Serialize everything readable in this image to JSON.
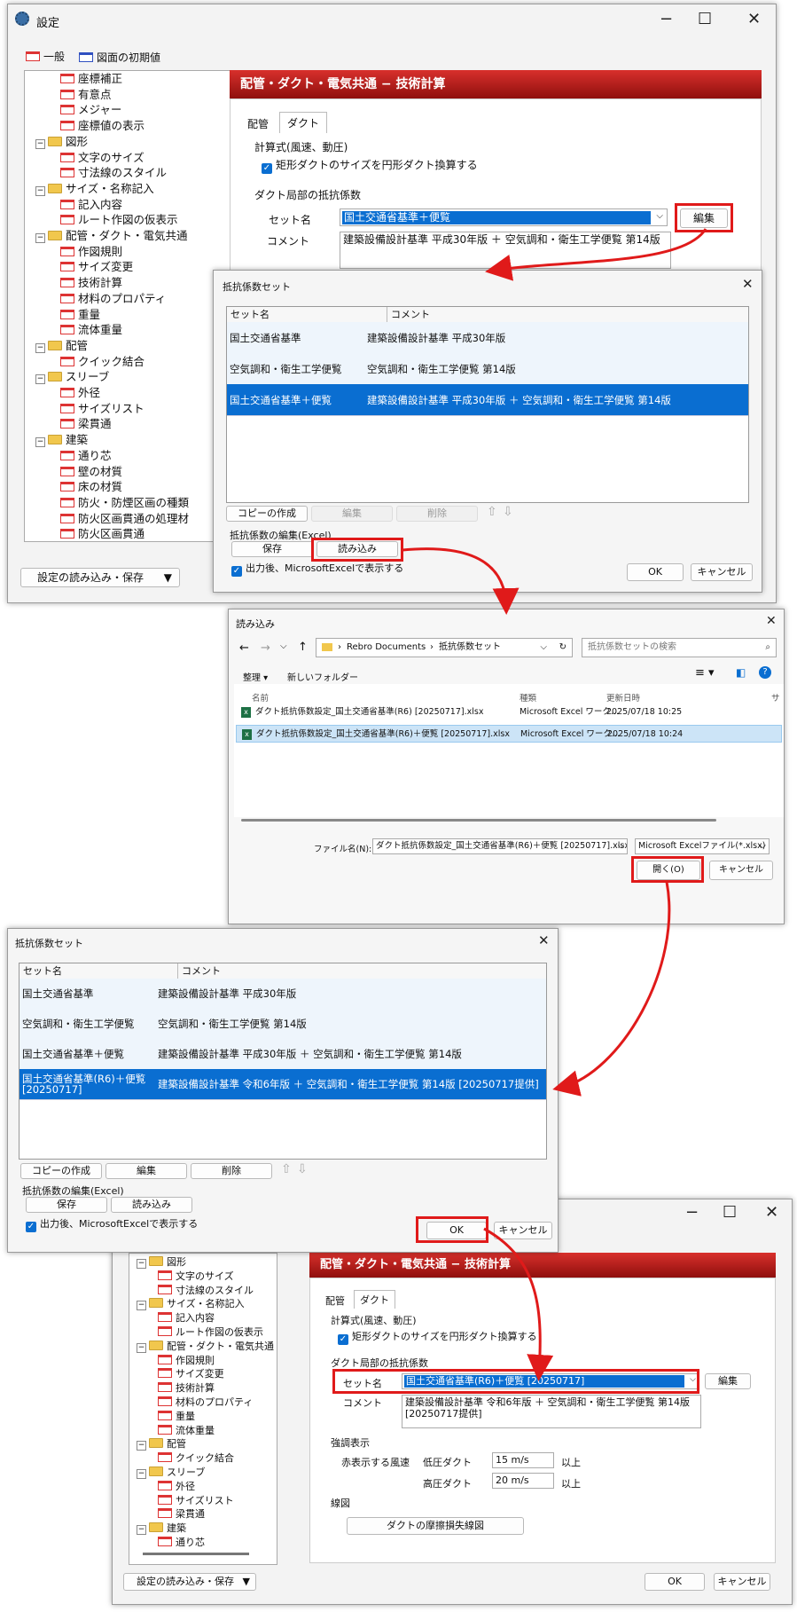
{
  "settings": {
    "title": "設定",
    "top_tabs": [
      "一般",
      "図面の初期値"
    ],
    "tree1": [
      {
        "label": "座標補正",
        "lvl": 2
      },
      {
        "label": "有意点",
        "lvl": 2
      },
      {
        "label": "メジャー",
        "lvl": 2
      },
      {
        "label": "座標値の表示",
        "lvl": 2
      },
      {
        "label": "図形",
        "lvl": 1
      },
      {
        "label": "文字のサイズ",
        "lvl": 2
      },
      {
        "label": "寸法線のスタイル",
        "lvl": 2
      },
      {
        "label": "サイズ・名称記入",
        "lvl": 1
      },
      {
        "label": "記入内容",
        "lvl": 2
      },
      {
        "label": "ルート作図の仮表示",
        "lvl": 2
      },
      {
        "label": "配管・ダクト・電気共通",
        "lvl": 1
      },
      {
        "label": "作図規則",
        "lvl": 2
      },
      {
        "label": "サイズ変更",
        "lvl": 2
      },
      {
        "label": "技術計算",
        "lvl": 2
      },
      {
        "label": "材料のプロパティ",
        "lvl": 2
      },
      {
        "label": "重量",
        "lvl": 2
      },
      {
        "label": "流体重量",
        "lvl": 2
      },
      {
        "label": "配管",
        "lvl": 1
      },
      {
        "label": "クイック結合",
        "lvl": 2
      },
      {
        "label": "スリーブ",
        "lvl": 1
      },
      {
        "label": "外径",
        "lvl": 2
      },
      {
        "label": "サイズリスト",
        "lvl": 2
      },
      {
        "label": "梁貫通",
        "lvl": 2
      },
      {
        "label": "建築",
        "lvl": 1
      },
      {
        "label": "通り芯",
        "lvl": 2
      },
      {
        "label": "壁の材質",
        "lvl": 2
      },
      {
        "label": "床の材質",
        "lvl": 2
      },
      {
        "label": "防火・防煙区画の種類",
        "lvl": 2
      },
      {
        "label": "防火区画貫通の処理材",
        "lvl": 2
      },
      {
        "label": "防火区画貫通",
        "lvl": 2
      }
    ],
    "load_save_btn": "設定の読み込み・保存",
    "panel_header": "配管・ダクト・電気共通 − 技術計算",
    "inner_tabs": [
      "配管",
      "ダクト"
    ],
    "formula_group": "計算式(風速、動圧)",
    "convert_check": "矩形ダクトのサイズを円形ダクト換算する",
    "resistance_group": "ダクト局部の抵抗係数",
    "set_name_label": "セット名",
    "set_name_value": "国土交通省基準＋便覧",
    "edit_btn": "編集",
    "comment_label": "コメント",
    "comment_value": "建築設備設計基準 平成30年版 ＋ 空気調和・衛生工学便覧 第14版"
  },
  "coef1": {
    "title": "抵抗係数セット",
    "col_set": "セット名",
    "col_comment": "コメント",
    "rows": [
      {
        "name": "国土交通省基準",
        "comment": "建築設備設計基準 平成30年版"
      },
      {
        "name": "空気調和・衛生工学便覧",
        "comment": "空気調和・衛生工学便覧 第14版"
      },
      {
        "name": "国土交通省基準＋便覧",
        "comment": "建築設備設計基準 平成30年版 ＋ 空気調和・衛生工学便覧 第14版"
      }
    ],
    "copy_btn": "コピーの作成",
    "edit_btn": "編集",
    "delete_btn": "削除",
    "excel_group": "抵抗係数の編集(Excel)",
    "save_btn": "保存",
    "load_btn": "読み込み",
    "show_excel_check": "出力後、MicrosoftExcelで表示する",
    "ok_btn": "OK",
    "cancel_btn": "キャンセル"
  },
  "open": {
    "title": "読み込み",
    "breadcrumb": [
      "Rebro Documents",
      "抵抗係数セット"
    ],
    "search_placeholder": "抵抗係数セットの検索",
    "organize": "整理",
    "new_folder": "新しいフォルダー",
    "col_name": "名前",
    "col_type": "種類",
    "col_date": "更新日時",
    "col_size": "サ",
    "files": [
      {
        "name": "ダクト抵抗係数設定_国土交通省基準(R6) [20250717].xlsx",
        "type": "Microsoft Excel ワーク...",
        "date": "2025/07/18 10:25"
      },
      {
        "name": "ダクト抵抗係数設定_国土交通省基準(R6)＋便覧 [20250717].xlsx",
        "type": "Microsoft Excel ワーク...",
        "date": "2025/07/18 10:24"
      }
    ],
    "filename_label": "ファイル名(N):",
    "filename_value": "ダクト抵抗係数設定_国土交通省基準(R6)＋便覧 [20250717].xlsx",
    "filter_value": "Microsoft Excelファイル(*.xlsx)",
    "open_btn": "開く(O)",
    "cancel_btn": "キャンセル"
  },
  "coef2": {
    "title": "抵抗係数セット",
    "col_set": "セット名",
    "col_comment": "コメント",
    "rows": [
      {
        "name": "国土交通省基準",
        "comment": "建築設備設計基準 平成30年版"
      },
      {
        "name": "空気調和・衛生工学便覧",
        "comment": "空気調和・衛生工学便覧 第14版"
      },
      {
        "name": "国土交通省基準＋便覧",
        "comment": "建築設備設計基準 平成30年版 ＋ 空気調和・衛生工学便覧 第14版"
      },
      {
        "name": "国土交通省基準(R6)＋便覧 [20250717]",
        "comment": "建築設備設計基準 令和6年版 ＋ 空気調和・衛生工学便覧 第14版 [20250717提供]"
      }
    ],
    "copy_btn": "コピーの作成",
    "edit_btn": "編集",
    "delete_btn": "削除",
    "excel_group": "抵抗係数の編集(Excel)",
    "save_btn": "保存",
    "load_btn": "読み込み",
    "show_excel_check": "出力後、MicrosoftExcelで表示する",
    "ok_btn": "OK",
    "cancel_btn": "キャンセル"
  },
  "settings2": {
    "tree": [
      {
        "label": "図形",
        "lvl": 1
      },
      {
        "label": "文字のサイズ",
        "lvl": 2
      },
      {
        "label": "寸法線のスタイル",
        "lvl": 2
      },
      {
        "label": "サイズ・名称記入",
        "lvl": 1
      },
      {
        "label": "記入内容",
        "lvl": 2
      },
      {
        "label": "ルート作図の仮表示",
        "lvl": 2
      },
      {
        "label": "配管・ダクト・電気共通",
        "lvl": 1
      },
      {
        "label": "作図規則",
        "lvl": 2
      },
      {
        "label": "サイズ変更",
        "lvl": 2
      },
      {
        "label": "技術計算",
        "lvl": 2
      },
      {
        "label": "材料のプロパティ",
        "lvl": 2
      },
      {
        "label": "重量",
        "lvl": 2
      },
      {
        "label": "流体重量",
        "lvl": 2
      },
      {
        "label": "配管",
        "lvl": 1
      },
      {
        "label": "クイック結合",
        "lvl": 2
      },
      {
        "label": "スリーブ",
        "lvl": 1
      },
      {
        "label": "外径",
        "lvl": 2
      },
      {
        "label": "サイズリスト",
        "lvl": 2
      },
      {
        "label": "梁貫通",
        "lvl": 2
      },
      {
        "label": "建築",
        "lvl": 1
      },
      {
        "label": "通り芯",
        "lvl": 2
      }
    ],
    "panel_header": "配管・ダクト・電気共通 − 技術計算",
    "inner_tabs": [
      "配管",
      "ダクト"
    ],
    "formula_group": "計算式(風速、動圧)",
    "convert_check": "矩形ダクトのサイズを円形ダクト換算する",
    "resistance_group": "ダクト局部の抵抗係数",
    "set_name_label": "セット名",
    "set_name_value": "国土交通省基準(R6)＋便覧 [20250717]",
    "edit_btn": "編集",
    "comment_label": "コメント",
    "comment_value": "建築設備設計基準 令和6年版 ＋ 空気調和・衛生工学便覧 第14版 [20250717提供]",
    "emphasis_group": "強調表示",
    "red_speed_label": "赤表示する風速",
    "low_label": "低圧ダクト",
    "low_value": "15 m/s",
    "high_label": "高圧ダクト",
    "high_value": "20 m/s",
    "above": "以上",
    "diagram_group": "線図",
    "diagram_btn": "ダクトの摩擦損失線図",
    "load_save_btn": "設定の読み込み・保存",
    "ok_btn": "OK",
    "cancel_btn": "キャンセル"
  },
  "colors": {
    "accent": "#e01a1a",
    "selection": "#0a6ed1",
    "header_dark": "#8f0f0d"
  }
}
